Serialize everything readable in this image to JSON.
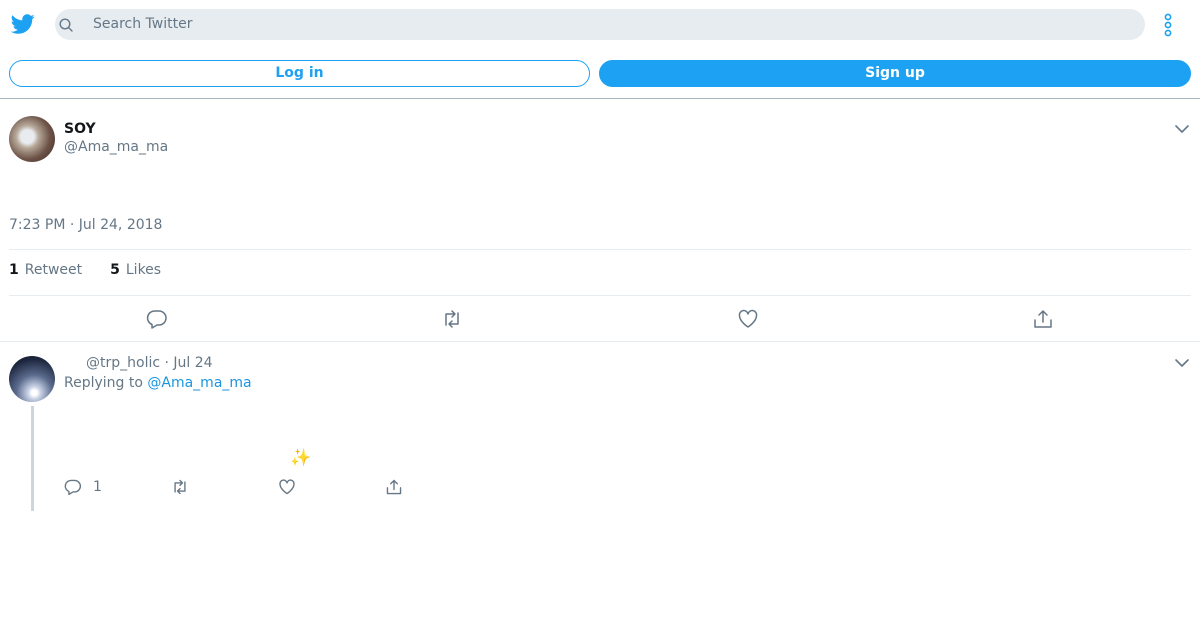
{
  "header": {
    "logo_icon": "twitter-bird-icon",
    "search_placeholder": "Search Twitter",
    "more_icon": "more-vertical-icon",
    "brand_color": "#1da1f2"
  },
  "auth": {
    "login_label": "Log in",
    "signup_label": "Sign up"
  },
  "tweet": {
    "author_name": "SOY",
    "author_handle": "@Ama_ma_ma",
    "timestamp": "7:23 PM · Jul 24, 2018",
    "retweets_count": "1",
    "retweets_label": "Retweet",
    "likes_count": "5",
    "likes_label": "Likes",
    "actions": [
      "reply-icon",
      "retweet-icon",
      "like-icon",
      "share-icon"
    ]
  },
  "reply": {
    "handle_and_date": "@trp_holic · Jul 24",
    "replying_prefix": "Replying to",
    "replying_to": "@Ama_ma_ma",
    "emoji": "✨",
    "reply_count": "1"
  }
}
